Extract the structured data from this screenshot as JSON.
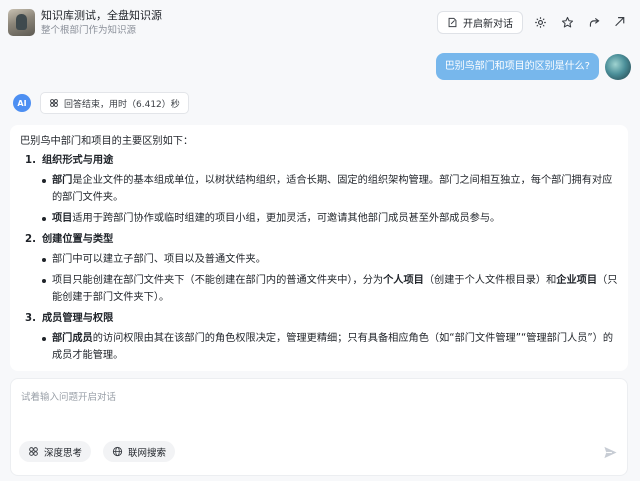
{
  "header": {
    "title": "知识库测试，全盘知识源",
    "subtitle": "整个根部门作为知识源",
    "new_chat_label": "开启新对话"
  },
  "user_message": "巴别鸟部门和项目的区别是什么?",
  "ai": {
    "badge": "AI",
    "status": "回答结束，用时（6.412）秒"
  },
  "answer": {
    "intro": "巴别鸟中部门和项目的主要区别如下：",
    "sections": [
      {
        "num": "1.",
        "heading": "组织形式与用途",
        "bullets": [
          {
            "bold": "部门",
            "text": "是企业文件的基本组成单位，以树状结构组织，适合长期、固定的组织架构管理。部门之间相互独立，每个部门拥有对应的部门文件夹。"
          },
          {
            "bold": "项目",
            "text": "适用于跨部门协作或临时组建的项目小组，更加灵活，可邀请其他部门成员甚至外部成员参与。"
          }
        ]
      },
      {
        "num": "2.",
        "heading": "创建位置与类型",
        "bullets": [
          {
            "text": "部门中可以建立子部门、项目以及普通文件夹。"
          },
          {
            "p1": "项目只能创建在部门文件夹下（不能创建在部门内的普通文件夹中），分为",
            "b1": "个人项目",
            "p2": "（创建于个人文件根目录）和",
            "b2": "企业项目",
            "p3": "（只能创建于部门文件夹下）。"
          }
        ]
      },
      {
        "num": "3.",
        "heading": "成员管理与权限",
        "bullets": [
          {
            "bold": "部门成员",
            "text": "的访问权限由其在该部门的角色权限决定，管理更精细；只有具备相应角色（如“部门文件管理”“管理部门人员”）的成员才能管理。"
          }
        ]
      }
    ]
  },
  "input": {
    "placeholder": "试着输入问题开启对话",
    "deep_think_label": "深度思考",
    "web_search_label": "联网搜索"
  },
  "colors": {
    "accent": "#4d8ff2",
    "user_bubble": "#77b7ec",
    "background": "#f7f8fa"
  },
  "icons": [
    "edit-icon",
    "settings-icon",
    "star-icon",
    "share-icon",
    "more-icon",
    "brain-icon",
    "globe-icon",
    "send-icon"
  ]
}
